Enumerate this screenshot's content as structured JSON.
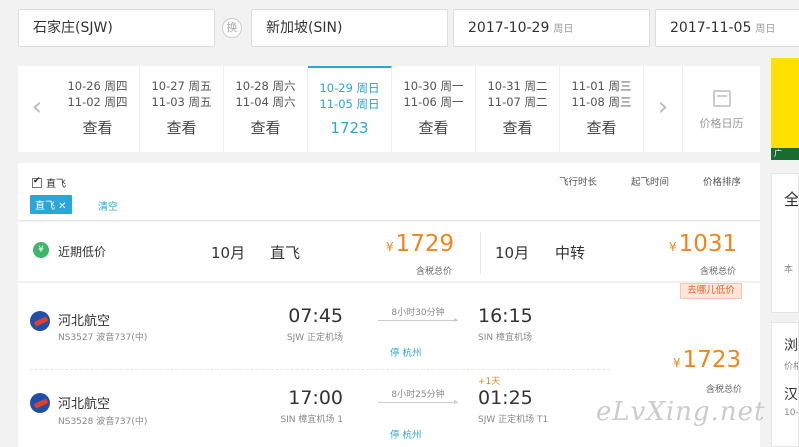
{
  "search": {
    "from": "石家庄(SJW)",
    "swap_label": "换",
    "to": "新加坡(SIN)",
    "depart_date": "2017-10-29",
    "depart_dow": "周日",
    "return_date": "2017-11-05",
    "return_dow": "周日"
  },
  "date_strip": {
    "prev_arrow": "‹",
    "next_arrow": "›",
    "cells": [
      {
        "d1": "10-26 周四",
        "d2": "11-02 周四",
        "price": "查看"
      },
      {
        "d1": "10-27 周五",
        "d2": "11-03 周五",
        "price": "查看"
      },
      {
        "d1": "10-28 周六",
        "d2": "11-04 周六",
        "price": "查看"
      },
      {
        "d1": "10-29 周日",
        "d2": "11-05 周日",
        "price": "1723"
      },
      {
        "d1": "10-30 周一",
        "d2": "11-06 周一",
        "price": "查看"
      },
      {
        "d1": "10-31 周二",
        "d2": "11-07 周二",
        "price": "查看"
      },
      {
        "d1": "11-01 周三",
        "d2": "11-08 周三",
        "price": "查看"
      }
    ],
    "calendar_label": "价格日历"
  },
  "ad": {
    "tag": "广"
  },
  "right_panel": {
    "card1_title": "全",
    "card1_sub": "本",
    "card2_title": "浏",
    "card2_sub": "价格",
    "card2_title2": "汉",
    "card2_sub2": "10-"
  },
  "filter": {
    "direct_checkbox": "直飞",
    "chip": "直飞 ✕",
    "clear": "清空",
    "sort_duration": "飞行时长",
    "sort_departure": "起飞时间",
    "sort_price": "价格排序"
  },
  "low_price": {
    "label": "近期低价",
    "yen_icon": "¥",
    "direct": {
      "month": "10月",
      "type": "直飞",
      "currency": "¥",
      "price": "1729",
      "tax": "含税总价"
    },
    "transfer": {
      "month": "10月",
      "type": "中转",
      "currency": "¥",
      "price": "1031",
      "tax": "含税总价"
    }
  },
  "cheap_tag": "去哪儿低价",
  "itinerary": {
    "outbound": {
      "airline": "河北航空",
      "flight_no": "NS3527 波音737(中)",
      "dep_time": "07:45",
      "dep_airport": "SJW 正定机场",
      "duration": "8小时30分钟",
      "stop_prefix": "停",
      "stop_city": "杭州",
      "arr_time": "16:15",
      "arr_airport": "SIN 樟宜机场"
    },
    "inbound": {
      "airline": "河北航空",
      "flight_no": "NS3528 波音737(中)",
      "dep_time": "17:00",
      "dep_airport": "SIN 樟宜机场 1",
      "duration": "8小时25分钟",
      "stop_prefix": "停",
      "stop_city": "杭州",
      "plus_day": "+1天",
      "arr_time": "01:25",
      "arr_airport": "SJW 正定机场 T1"
    },
    "currency": "¥",
    "total_price": "1723",
    "tax": "含税总价"
  },
  "watermark": "eLvXing.net"
}
